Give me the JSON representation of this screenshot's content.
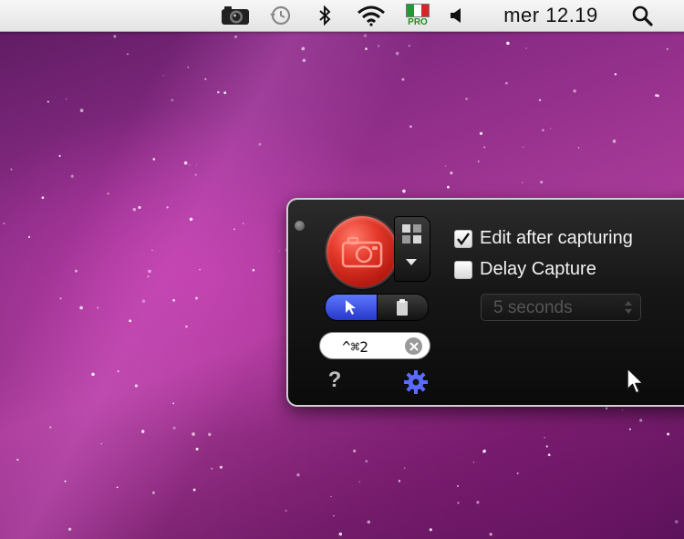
{
  "menubar": {
    "clock": "mer 12.19",
    "pro_badge": "PRO",
    "icons": [
      "camera-icon",
      "time-machine-icon",
      "bluetooth-icon",
      "wifi-icon",
      "italian-flag-icon",
      "volume-icon",
      "spotlight-search-icon"
    ]
  },
  "panel": {
    "hotkey": "^⌘2",
    "options": {
      "edit_after_capturing": {
        "label": "Edit after capturing",
        "checked": true
      },
      "delay_capture": {
        "label": "Delay Capture",
        "checked": false
      }
    },
    "delay_select": {
      "value": "5 seconds",
      "enabled": false
    },
    "help_label": "?"
  },
  "colors": {
    "capture_red": "#e53a2b",
    "segment_blue": "#3a50e0",
    "gear_blue": "#5a6cff",
    "pro_green": "#1d8f1d"
  }
}
